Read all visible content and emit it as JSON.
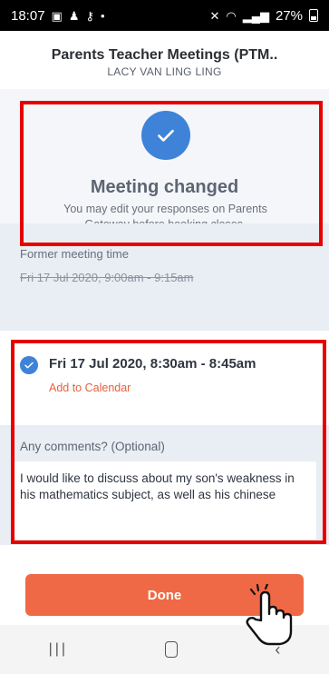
{
  "status_bar": {
    "time": "18:07",
    "battery": "27%"
  },
  "header": {
    "title": "Parents Teacher Meetings (PTM..",
    "subtitle": "LACY VAN LING LING"
  },
  "status": {
    "title": "Meeting changed",
    "message": "You may edit your responses on Parents Gateway before booking closes."
  },
  "former": {
    "label": "Former meeting time",
    "time": "Fri 17 Jul 2020, 9:00am - 9:15am"
  },
  "new_meeting": {
    "time": "Fri 17 Jul 2020, 8:30am - 8:45am",
    "add_calendar": "Add to Calendar"
  },
  "comments": {
    "label": "Any comments? (Optional)",
    "value": "I would like to discuss about my son's weakness in his mathematics subject, as well as his chinese"
  },
  "done_label": "Done",
  "colors": {
    "accent": "#3f83d8",
    "button": "#ef6946",
    "annotation": "#e60000"
  }
}
